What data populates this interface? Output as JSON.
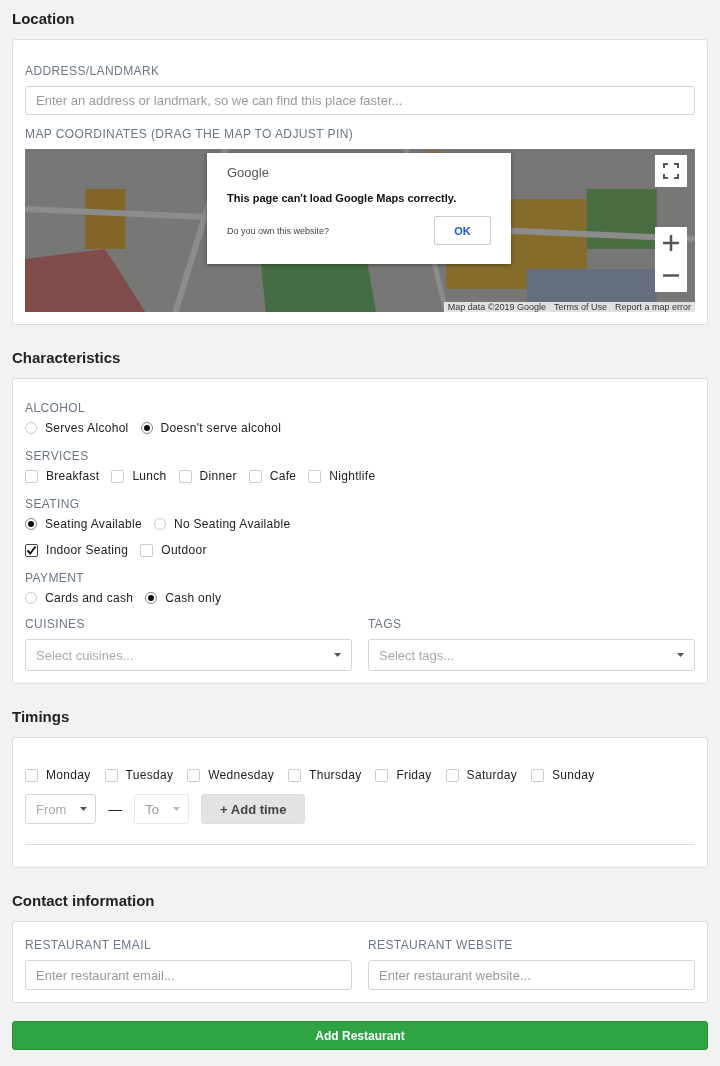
{
  "location": {
    "heading": "Location",
    "address": {
      "label": "ADDRESS/LANDMARK",
      "placeholder": "Enter an address or landmark, so we can find this place faster..."
    },
    "map": {
      "label": "MAP COORDINATES (DRAG THE MAP TO ADJUST PIN)",
      "dialog": {
        "brand": "Google",
        "message": "This page can't load Google Maps correctly.",
        "question": "Do you own this website?",
        "button": "OK"
      },
      "attribution": [
        "Map data ©2019 Google",
        "Terms of Use",
        "Report a map error"
      ]
    }
  },
  "characteristics": {
    "heading": "Characteristics",
    "groups": [
      {
        "label": "ALCOHOL",
        "rows": [
          {
            "kind": "radio",
            "options": [
              {
                "label": "Serves Alcohol",
                "selected": false
              },
              {
                "label": "Doesn't serve alcohol",
                "selected": true
              }
            ]
          }
        ]
      },
      {
        "label": "SERVICES",
        "rows": [
          {
            "kind": "checkbox",
            "options": [
              {
                "label": "Breakfast",
                "checked": false
              },
              {
                "label": "Lunch",
                "checked": false
              },
              {
                "label": "Dinner",
                "checked": false
              },
              {
                "label": "Cafe",
                "checked": false
              },
              {
                "label": "Nightlife",
                "checked": false
              }
            ]
          }
        ]
      },
      {
        "label": "SEATING",
        "rows": [
          {
            "kind": "radio",
            "options": [
              {
                "label": "Seating Available",
                "selected": true
              },
              {
                "label": "No Seating Available",
                "selected": false
              }
            ]
          },
          {
            "kind": "checkbox",
            "options": [
              {
                "label": "Indoor Seating",
                "checked": true
              },
              {
                "label": "Outdoor",
                "checked": false
              }
            ]
          }
        ]
      },
      {
        "label": "PAYMENT",
        "rows": [
          {
            "kind": "radio",
            "options": [
              {
                "label": "Cards and cash",
                "selected": false
              },
              {
                "label": "Cash only",
                "selected": true
              }
            ]
          }
        ]
      }
    ],
    "selects": [
      {
        "label": "CUISINES",
        "placeholder": "Select cuisines..."
      },
      {
        "label": "TAGS",
        "placeholder": "Select tags..."
      }
    ]
  },
  "timings": {
    "heading": "Timings",
    "days": [
      {
        "label": "Monday",
        "checked": false
      },
      {
        "label": "Tuesday",
        "checked": false
      },
      {
        "label": "Wednesday",
        "checked": false
      },
      {
        "label": "Thursday",
        "checked": false
      },
      {
        "label": "Friday",
        "checked": false
      },
      {
        "label": "Saturday",
        "checked": false
      },
      {
        "label": "Sunday",
        "checked": false
      }
    ],
    "from": {
      "placeholder": "From",
      "disabled": false
    },
    "separator": "—",
    "to": {
      "placeholder": "To",
      "disabled": true
    },
    "add_button": "+ Add time"
  },
  "contact": {
    "heading": "Contact information",
    "fields": [
      {
        "label": "RESTAURANT EMAIL",
        "placeholder": "Enter restaurant email..."
      },
      {
        "label": "RESTAURANT WEBSITE",
        "placeholder": "Enter restaurant website..."
      }
    ]
  },
  "submit": "Add Restaurant"
}
